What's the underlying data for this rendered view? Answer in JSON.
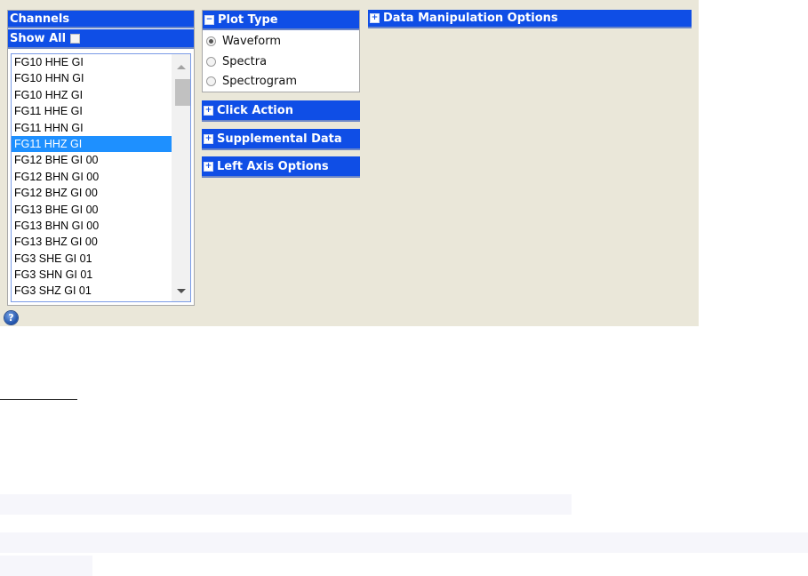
{
  "channels": {
    "title": "Channels",
    "show_all_label": "Show All",
    "items": [
      "FG10 HHE GI",
      "FG10 HHN GI",
      "FG10 HHZ GI",
      "FG11 HHE GI",
      "FG11 HHN GI",
      "FG11 HHZ GI",
      "FG12 BHE GI 00",
      "FG12 BHN GI 00",
      "FG12 BHZ GI 00",
      "FG13 BHE GI 00",
      "FG13 BHN GI 00",
      "FG13 BHZ GI 00",
      "FG3 SHE GI 01",
      "FG3 SHN GI 01",
      "FG3 SHZ GI 01"
    ],
    "selected_index": 5
  },
  "plot_type": {
    "title": "Plot Type",
    "toggle_icon": "minus",
    "options": [
      "Waveform",
      "Spectra",
      "Spectrogram"
    ],
    "selected": "Waveform"
  },
  "sections": {
    "click_action": "Click Action",
    "supplemental_data": "Supplemental Data",
    "left_axis_options": "Left Axis Options",
    "data_manipulation": "Data Manipulation Options",
    "toggle_icon": "plus"
  },
  "help": {
    "icon": "?"
  },
  "colors": {
    "header_blue": "#0f4ee6",
    "panel_bg": "#eae7d9",
    "selection": "#1e90ff"
  }
}
